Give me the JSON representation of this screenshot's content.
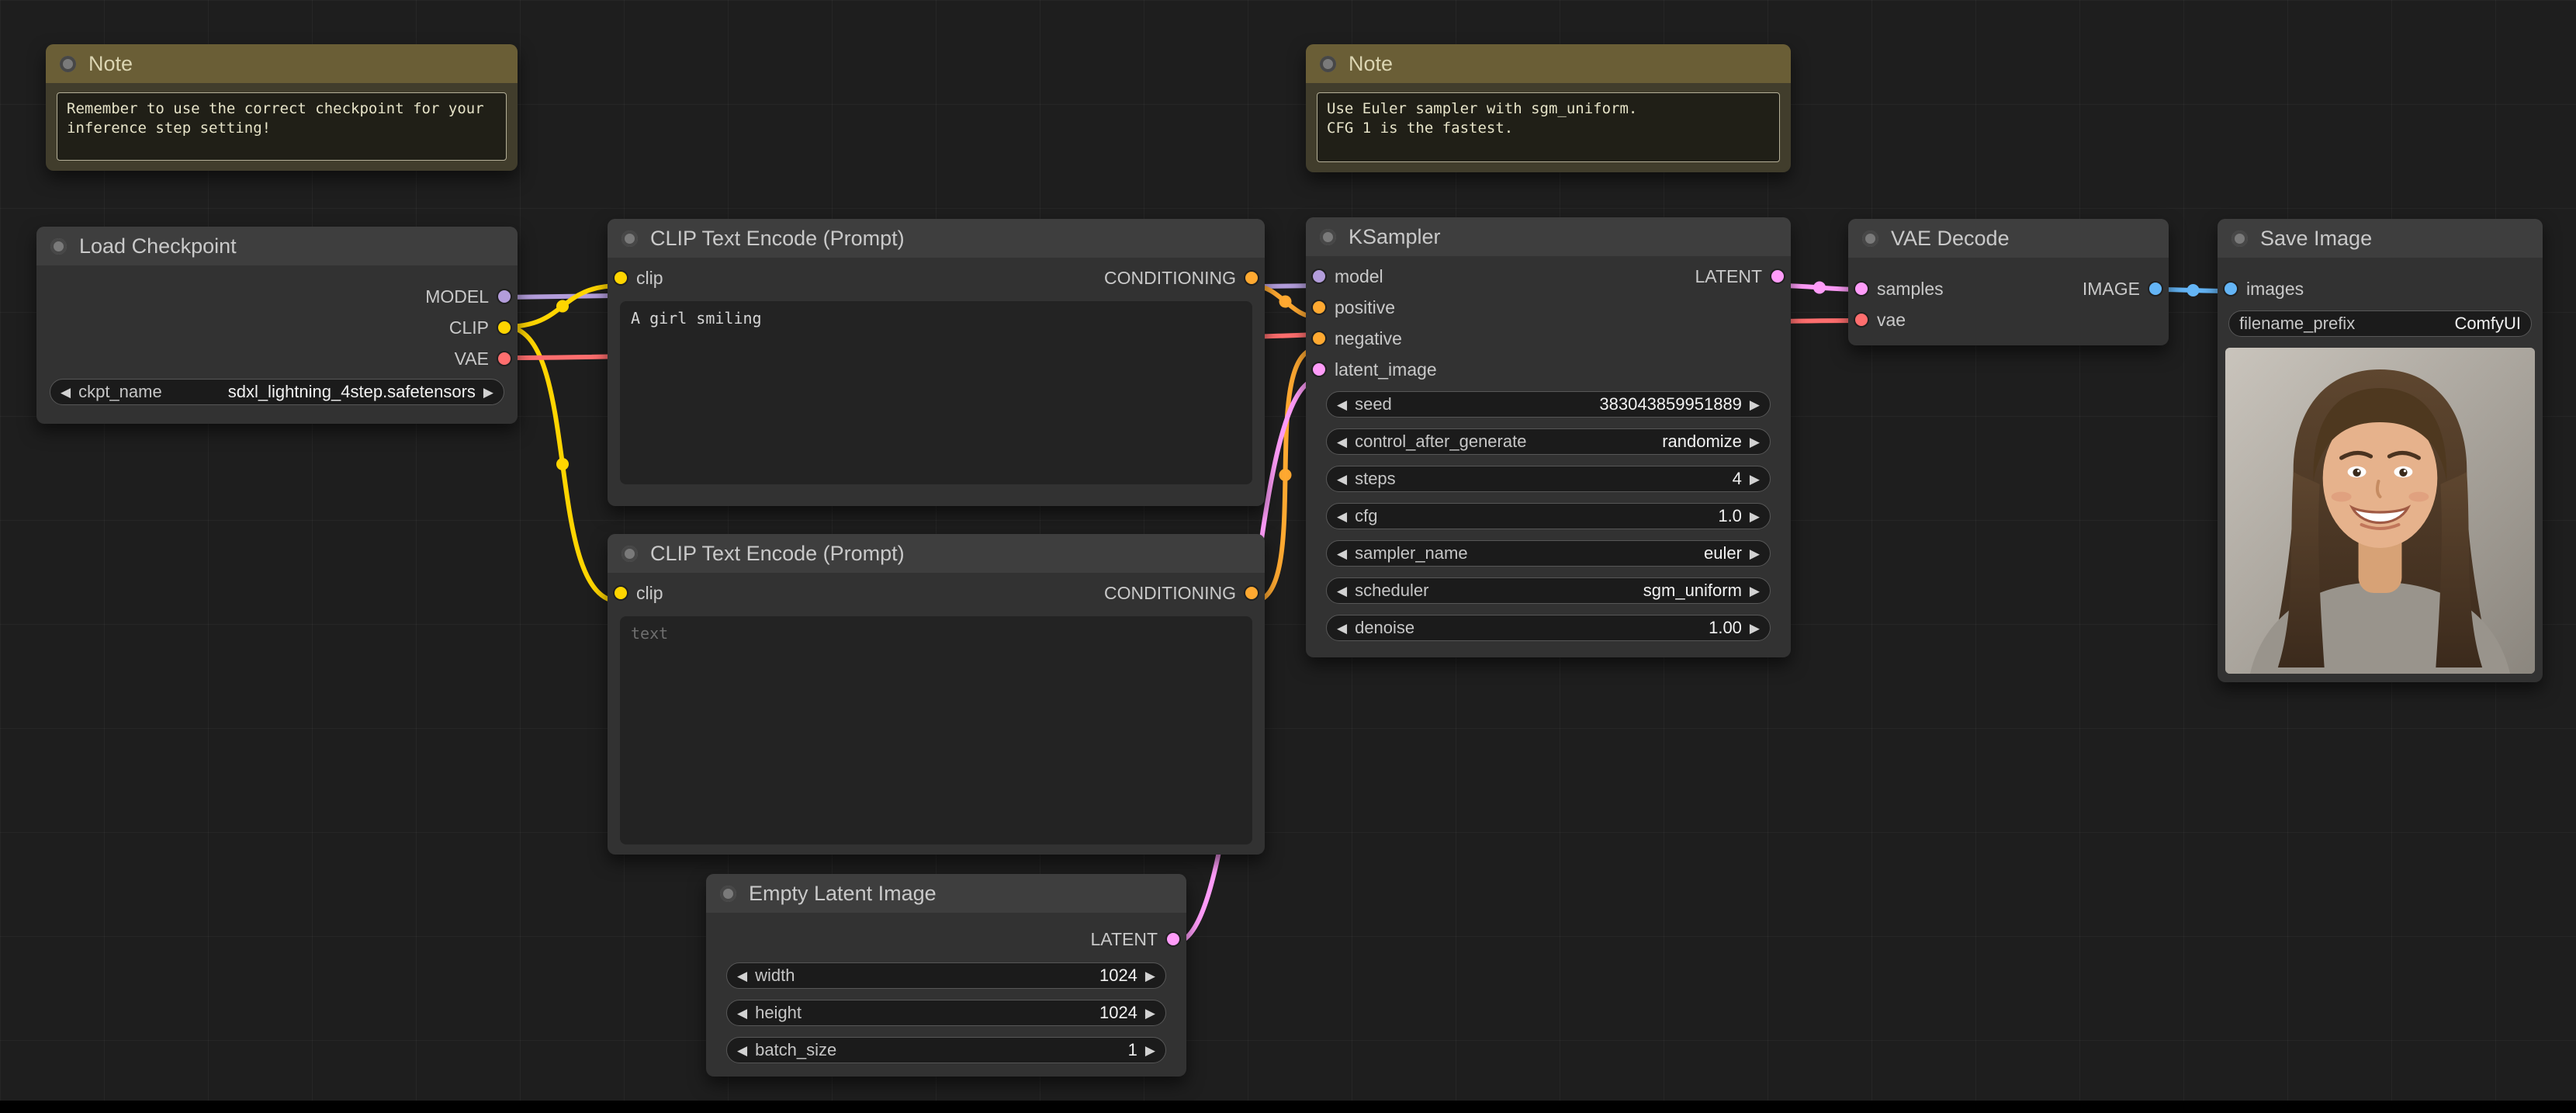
{
  "app": {
    "name": "ComfyUI workflow canvas"
  },
  "colors": {
    "model": "#B39DDB",
    "clip": "#FFD500",
    "vae": "#FF6E6E",
    "conditioning": "#FFA931",
    "latent": "#FF9CF9",
    "image": "#64B5F6"
  },
  "nodes": {
    "note1": {
      "title": "Note",
      "text": "Remember to use the correct checkpoint for your inference step setting!"
    },
    "note2": {
      "title": "Note",
      "text": "Use Euler sampler with sgm_uniform.\nCFG 1 is the fastest."
    },
    "load_checkpoint": {
      "title": "Load Checkpoint",
      "outputs": [
        {
          "label": "MODEL"
        },
        {
          "label": "CLIP"
        },
        {
          "label": "VAE"
        }
      ],
      "widgets": [
        {
          "label": "ckpt_name",
          "value": "sdxl_lightning_4step.safetensors"
        }
      ]
    },
    "clip_positive": {
      "title": "CLIP Text Encode (Prompt)",
      "inputs": [
        {
          "label": "clip"
        }
      ],
      "outputs": [
        {
          "label": "CONDITIONING"
        }
      ],
      "text": "A girl smiling"
    },
    "clip_negative": {
      "title": "CLIP Text Encode (Prompt)",
      "inputs": [
        {
          "label": "clip"
        }
      ],
      "outputs": [
        {
          "label": "CONDITIONING"
        }
      ],
      "text": "",
      "placeholder": "text"
    },
    "ksampler": {
      "title": "KSampler",
      "inputs": [
        {
          "label": "model"
        },
        {
          "label": "positive"
        },
        {
          "label": "negative"
        },
        {
          "label": "latent_image"
        }
      ],
      "outputs": [
        {
          "label": "LATENT"
        }
      ],
      "widgets": [
        {
          "label": "seed",
          "value": "383043859951889"
        },
        {
          "label": "control_after_generate",
          "value": "randomize"
        },
        {
          "label": "steps",
          "value": "4"
        },
        {
          "label": "cfg",
          "value": "1.0"
        },
        {
          "label": "sampler_name",
          "value": "euler"
        },
        {
          "label": "scheduler",
          "value": "sgm_uniform"
        },
        {
          "label": "denoise",
          "value": "1.00"
        }
      ]
    },
    "vae_decode": {
      "title": "VAE Decode",
      "inputs": [
        {
          "label": "samples"
        },
        {
          "label": "vae"
        }
      ],
      "outputs": [
        {
          "label": "IMAGE"
        }
      ]
    },
    "save_image": {
      "title": "Save Image",
      "inputs": [
        {
          "label": "images"
        }
      ],
      "widgets": [
        {
          "label": "filename_prefix",
          "value": "ComfyUI"
        }
      ],
      "preview": "portrait photo of a smiling young woman with long brown hair"
    },
    "empty_latent": {
      "title": "Empty Latent Image",
      "outputs": [
        {
          "label": "LATENT"
        }
      ],
      "widgets": [
        {
          "label": "width",
          "value": "1024"
        },
        {
          "label": "height",
          "value": "1024"
        },
        {
          "label": "batch_size",
          "value": "1"
        }
      ]
    }
  }
}
